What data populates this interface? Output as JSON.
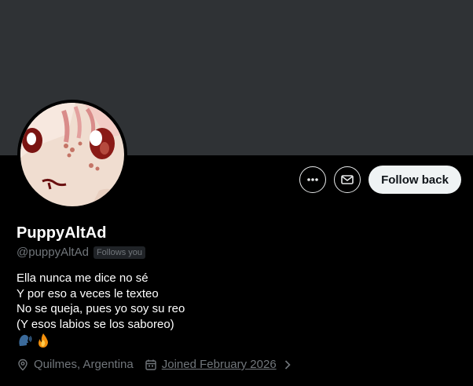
{
  "profile": {
    "display_name": "PuppyAltAd",
    "handle": "@puppyAltAd",
    "follows_you_badge": "Follows you",
    "bio_lines": [
      "Ella nunca me dice no sé",
      "Y por eso a veces le texteo",
      "No se queja, pues yo soy su reo",
      "(Y esos labios se los saboreo)"
    ],
    "bio_emoji": [
      "speaking-head-emoji",
      "fire-emoji"
    ],
    "location": "Quilmes, Argentina",
    "joined": "Joined February 2026"
  },
  "actions": {
    "more_icon": "more-horizontal-icon",
    "message_icon": "envelope-icon",
    "follow_back_label": "Follow back"
  },
  "icons": {
    "location": "map-pin-icon",
    "calendar": "calendar-icon",
    "chevron": "chevron-right-icon"
  },
  "colors": {
    "background": "#000000",
    "banner": "#2f3235",
    "secondary_text": "#71767b",
    "follow_button": "#eff3f4"
  }
}
